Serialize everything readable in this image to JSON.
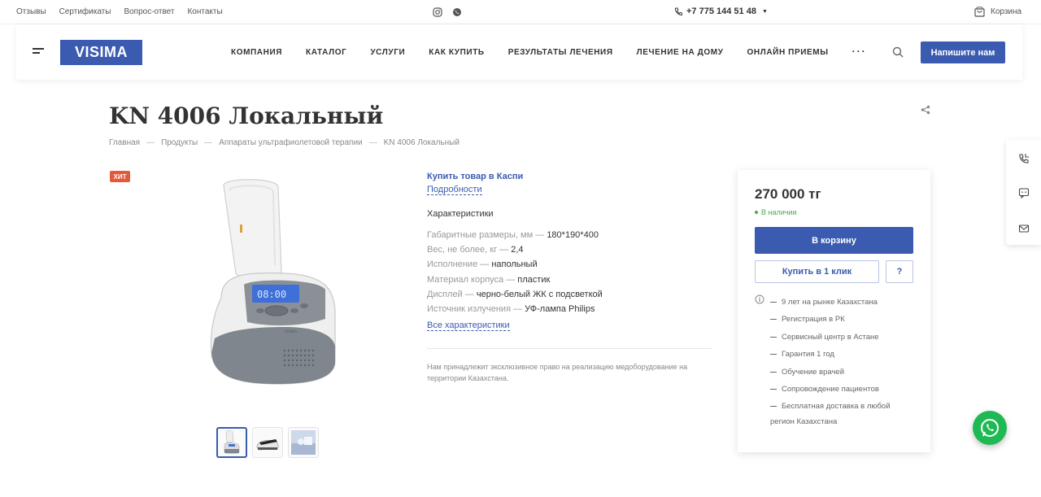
{
  "topbar": {
    "links": [
      "Отзывы",
      "Сертификаты",
      "Вопрос-ответ",
      "Контакты"
    ],
    "phone": "+7 775 144 51 48",
    "cart_label": "Корзина"
  },
  "header": {
    "logo": "VISIMA",
    "nav": [
      "КОМПАНИЯ",
      "КАТАЛОГ",
      "УСЛУГИ",
      "КАК КУПИТЬ",
      "РЕЗУЛЬТАТЫ ЛЕЧЕНИЯ",
      "ЛЕЧЕНИЕ НА ДОМУ",
      "ОНЛАЙН ПРИЕМЫ"
    ],
    "more": "···",
    "write_button": "Напишите нам"
  },
  "product": {
    "title": "KN 4006 Локальный",
    "breadcrumbs": [
      "Главная",
      "Продукты",
      "Аппараты ультрафиолетовой терапии",
      "KN 4006 Локальный"
    ],
    "badge": "ХИТ",
    "screen_text": "08:00",
    "brand_on_device": "KERNEL",
    "kaspi_link": "Купить товар в Каспи",
    "details_link": "Подробности",
    "characteristics_title": "Характеристики",
    "characteristics": [
      {
        "key": "Габаритные размеры, мм",
        "value": "180*190*400"
      },
      {
        "key": "Вес, не более, кг",
        "value": "2,4"
      },
      {
        "key": "Исполнение",
        "value": "напольный"
      },
      {
        "key": "Материал корпуса",
        "value": "пластик"
      },
      {
        "key": "Дисплей",
        "value": "черно-белый ЖК с подсветкой"
      },
      {
        "key": "Источник излучения",
        "value": "УФ-лампа Philips"
      }
    ],
    "all_characteristics_link": "Все характеристики",
    "note": "Нам принадлежит эксклюзивное право на реализацию медоборудование на территории Казахстана."
  },
  "buy_card": {
    "price": "270 000 тг",
    "stock": "В наличии",
    "cart_button": "В корзину",
    "one_click_button": "Купить в 1 клик",
    "question_button": "?",
    "benefits": [
      "9 лет на рынке Казахстана",
      "Регистрация в РК",
      "Сервисный центр в Астане",
      "Гарантия 1 год",
      "Обучение врачей",
      "Сопровождение пациентов",
      "Бесплатная доставка в любой"
    ],
    "benefit_continuation": "регион Казахстана"
  },
  "colors": {
    "accent": "#3b5bb0",
    "badge": "#e25a3a",
    "stock": "#4aa94e",
    "whatsapp": "#1fb954"
  },
  "icons": [
    "instagram-icon",
    "whatsapp-icon",
    "phone-icon",
    "cart-icon",
    "menu-icon",
    "search-icon",
    "share-icon",
    "info-icon",
    "callback-icon",
    "chat-icon",
    "mail-icon"
  ]
}
